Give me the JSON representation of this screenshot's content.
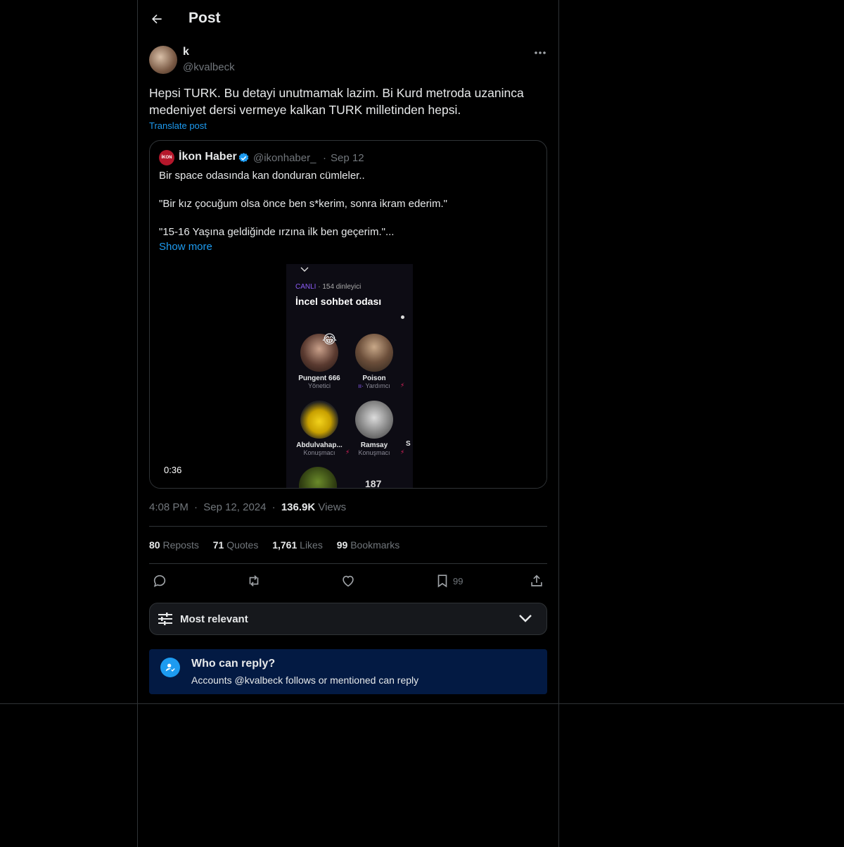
{
  "header": {
    "title": "Post"
  },
  "post": {
    "author_name": "k",
    "author_handle": "@kvalbeck",
    "text_line1": "Hepsi TURK. Bu detayi unutmamak lazim. Bi Kurd metroda uzaninca",
    "text_line2": "medeniyet dersi vermeye kalkan TURK milletinden hepsi.",
    "translate_label": "Translate post",
    "time": "4:08 PM",
    "date": "Sep 12, 2024",
    "views_count": "136.9K",
    "views_label": "Views"
  },
  "quote": {
    "logo_text": "İKON",
    "name": "İkon Haber",
    "handle": "@ikonhaber_",
    "date": "Sep 12",
    "line1": "Bir space odasında kan donduran cümleler..",
    "line2": "\"Bir kız çocuğum olsa önce ben s*kerim, sonra ikram ederim.\"",
    "line3": "\"15-16 Yaşına geldiğinde ırzına ilk ben geçerim.\"...",
    "show_more": "Show more",
    "video_duration": "0:36",
    "space": {
      "live_label": "CANLI",
      "listeners": "· 154 dinleyici",
      "room_title": "İncel sohbet odası",
      "speakers": [
        {
          "name": "Pungent 666",
          "role": "Yönetici"
        },
        {
          "name": "Poison",
          "role": "Yardımcı"
        },
        {
          "name": "Abdulvahap...",
          "role": "Konuşmacı"
        },
        {
          "name": "Ramsay",
          "role": "Konuşmacı"
        },
        {
          "name": "S",
          "role": ""
        }
      ],
      "partial_number": "187"
    }
  },
  "stats": {
    "reposts_count": "80",
    "reposts_label": "Reposts",
    "quotes_count": "71",
    "quotes_label": "Quotes",
    "likes_count": "1,761",
    "likes_label": "Likes",
    "bookmarks_count": "99",
    "bookmarks_label": "Bookmarks"
  },
  "actions": {
    "bookmark_count": "99"
  },
  "sort": {
    "label": "Most relevant"
  },
  "reply_info": {
    "title": "Who can reply?",
    "subtitle": "Accounts @kvalbeck follows or mentioned can reply"
  },
  "colors": {
    "accent": "#1d9bf0",
    "text": "#e7e9ea",
    "muted": "#71767b",
    "border": "#2f3336",
    "info_bg": "#031a43"
  }
}
